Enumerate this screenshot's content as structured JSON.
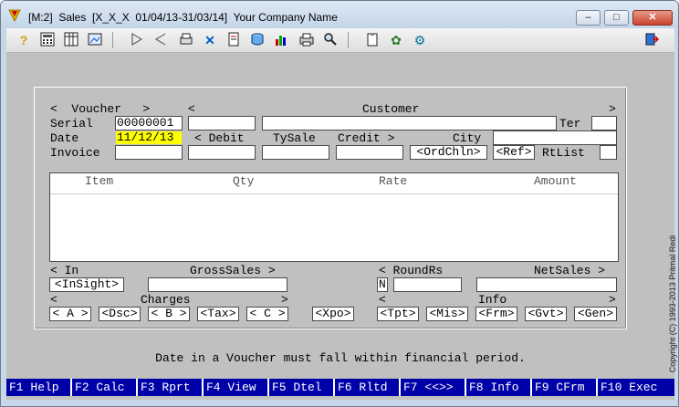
{
  "window": {
    "title": "[M:2]  Sales  [X_X_X  01/04/13-31/03/14]  Your Company Name",
    "minimize_glyph": "–",
    "maximize_glyph": "□",
    "close_glyph": "✕"
  },
  "toolbar": {
    "icons": [
      "help-icon",
      "calculator-icon",
      "table-icon",
      "image-icon",
      "play-icon",
      "back-icon",
      "print-setup-icon",
      "tools-icon",
      "document-icon",
      "database-icon",
      "chart-icon",
      "printer-icon",
      "search-icon",
      "clipboard-icon",
      "palette-icon",
      "settings-icon",
      "exit-icon"
    ]
  },
  "voucher": {
    "header_label": "<  Voucher   >",
    "serial_label": "Serial",
    "serial_value": "00000001",
    "date_label": "Date",
    "date_value": "11/12/13",
    "invoice_label": "Invoice",
    "invoice_value": ""
  },
  "customer": {
    "header_left": "<",
    "header_label": "Customer",
    "header_right": ">",
    "code_value": "",
    "name_value": "",
    "ter_label": "Ter",
    "ter_value": "",
    "debit_label": "< Debit",
    "tysale_label": "TySale",
    "credit_label": "Credit >",
    "city_label": "City",
    "city_value": "",
    "debit_value": "",
    "tysale_value": "",
    "credit_value": "",
    "ordchln_button": "<OrdChln>",
    "ref_button": "<Ref>",
    "rtlist_label": "RtList",
    "rtlist_value": ""
  },
  "grid": {
    "headers": [
      "Item",
      "Qty",
      "Rate",
      "Amount"
    ]
  },
  "summary": {
    "in_label": "< In",
    "insight_button": "<InSight>",
    "grosssales_label": "GrossSales >",
    "grosssales_value": "",
    "roundrs_label": "< RoundRs",
    "roundrs_flag": "N",
    "roundrs_value": "",
    "netsales_label": "NetSales >",
    "netsales_value": "",
    "charges_left": "<",
    "charges_label": "Charges",
    "charges_right": ">",
    "charge_buttons": [
      "< A >",
      "<Dsc>",
      "< B >",
      "<Tax>",
      "< C >"
    ],
    "xpo_button": "<Xpo>",
    "info_left": "<",
    "info_label": "Info",
    "info_right": ">",
    "info_buttons": [
      "<Tpt>",
      "<Mis>",
      "<Frm>",
      "<Gvt>",
      "<Gen>"
    ]
  },
  "status_message": "Date in a Voucher must fall within financial period.",
  "fkeys": [
    "F1 Help",
    "F2 Calc",
    "F3 Rprt",
    "F4 View",
    "F5 Dtel",
    "F6 Rltd",
    "F7 <<>>",
    "F8 Info",
    "F9 CFrm",
    "F10 Exec"
  ],
  "copyright": "Copyright (C) 1993-2013 Pritmal Redi"
}
